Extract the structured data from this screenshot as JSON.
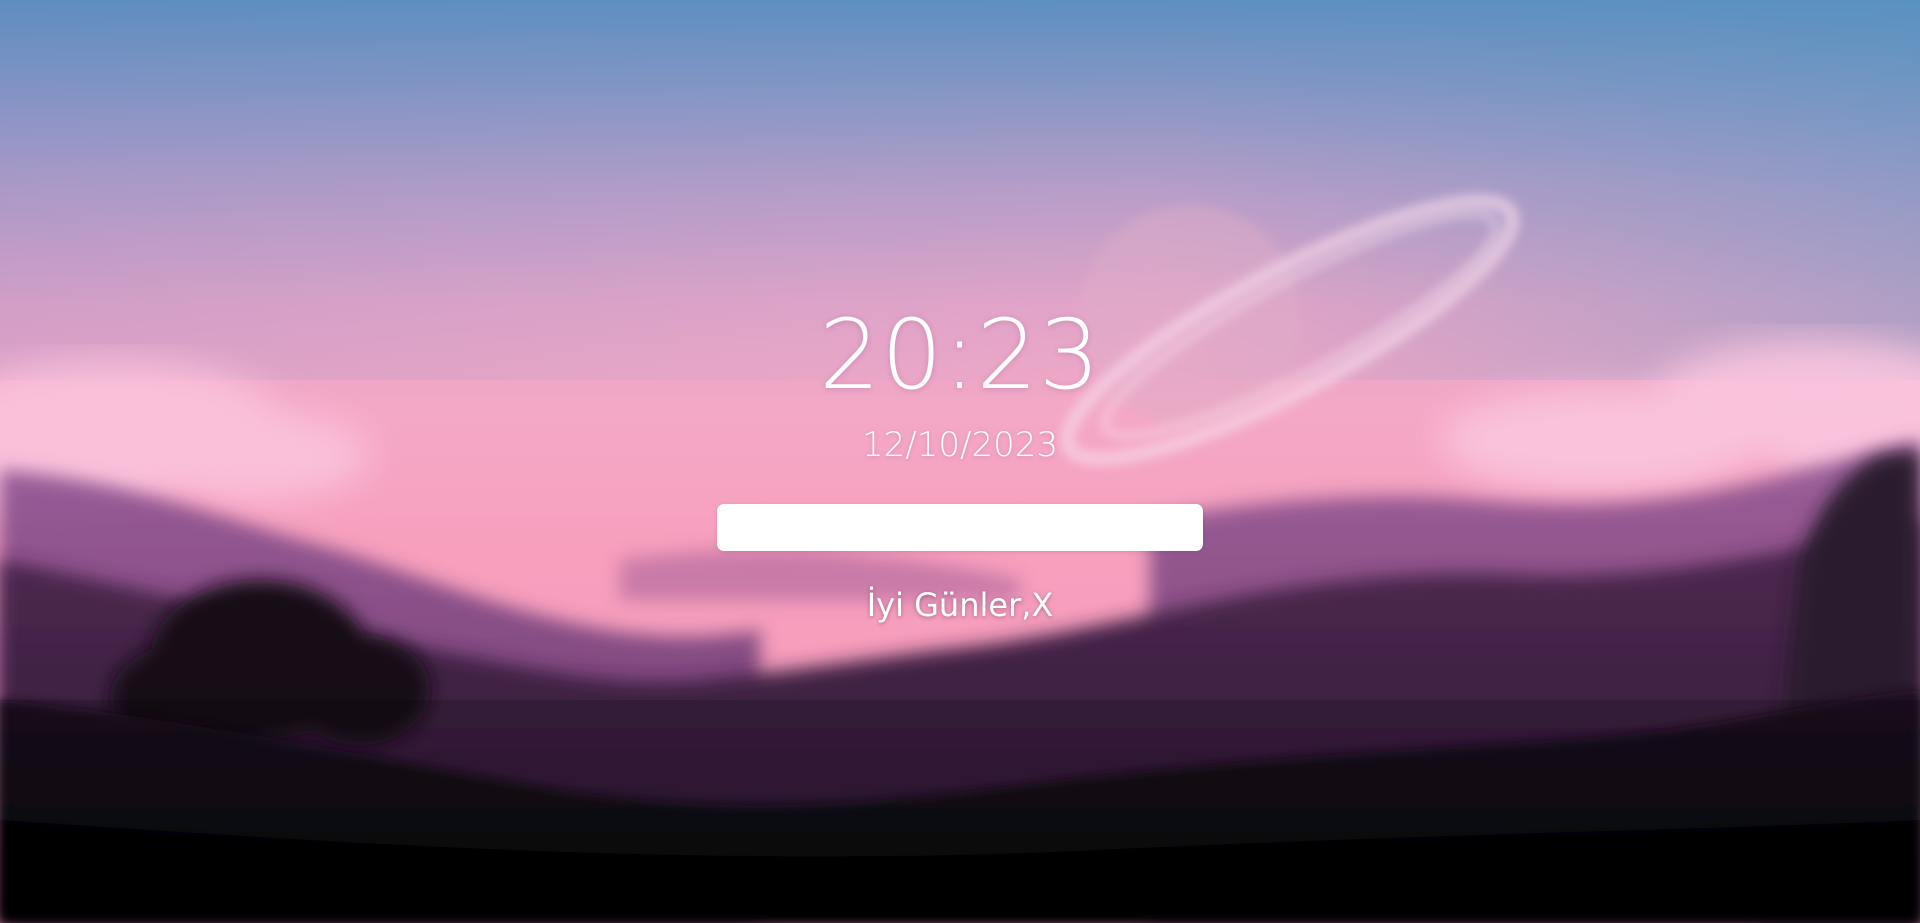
{
  "lock_screen": {
    "time": "20:23",
    "date": "12/10/2023",
    "search": {
      "value": "",
      "placeholder": ""
    },
    "greeting": "İyi Günler,X"
  },
  "colors": {
    "sky_top": "#5b8fbf",
    "sky_mid": "#c49ac4",
    "horizon": "#f7a6c4",
    "mountains_far": "#8a4c86",
    "mountains_near": "#3a2140",
    "foreground": "#07040a",
    "text": "#ffffff",
    "input_background": "#ffffff"
  }
}
